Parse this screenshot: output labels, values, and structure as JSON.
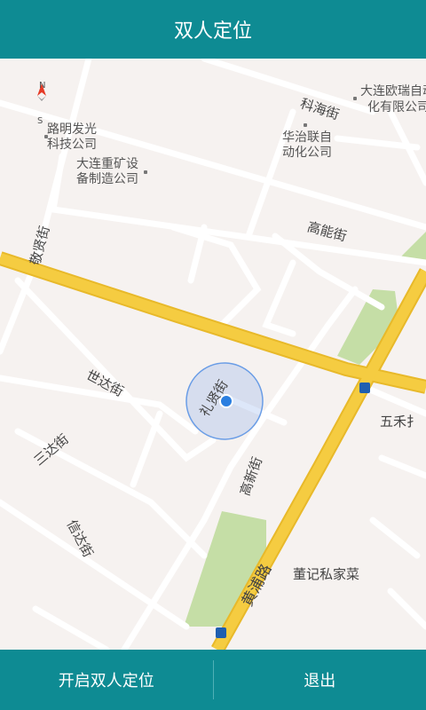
{
  "header": {
    "title": "双人定位"
  },
  "map": {
    "labels": {
      "keji": "科海街",
      "dalian_ourui_1": "大连欧瑞自动",
      "dalian_ourui_2": "化有限公司",
      "luming_1": "路明发光",
      "luming_2": "科技公司",
      "huazhi_1": "华治联自",
      "huazhi_2": "动化公司",
      "zhongkuang_1": "大连重矿设",
      "zhongkuang_2": "备制造公司",
      "jingxian": "敬贤街",
      "gaoneng": "高能街",
      "shida": "世达街",
      "lixian": "礼贤街",
      "sanda": "三达街",
      "gaoxin": "高新街",
      "wuhe": "五禾扌",
      "xinda": "信达街",
      "huangpu": "黄浦路",
      "dongji": "董记私家菜"
    },
    "compass": {
      "north": "N",
      "south": "S"
    },
    "colors": {
      "main_road": "#f5cc41",
      "road": "#ffffff",
      "park": "#c5dea6",
      "location": "#2a7ee0"
    }
  },
  "footer": {
    "start_label": "开启双人定位",
    "exit_label": "退出"
  }
}
